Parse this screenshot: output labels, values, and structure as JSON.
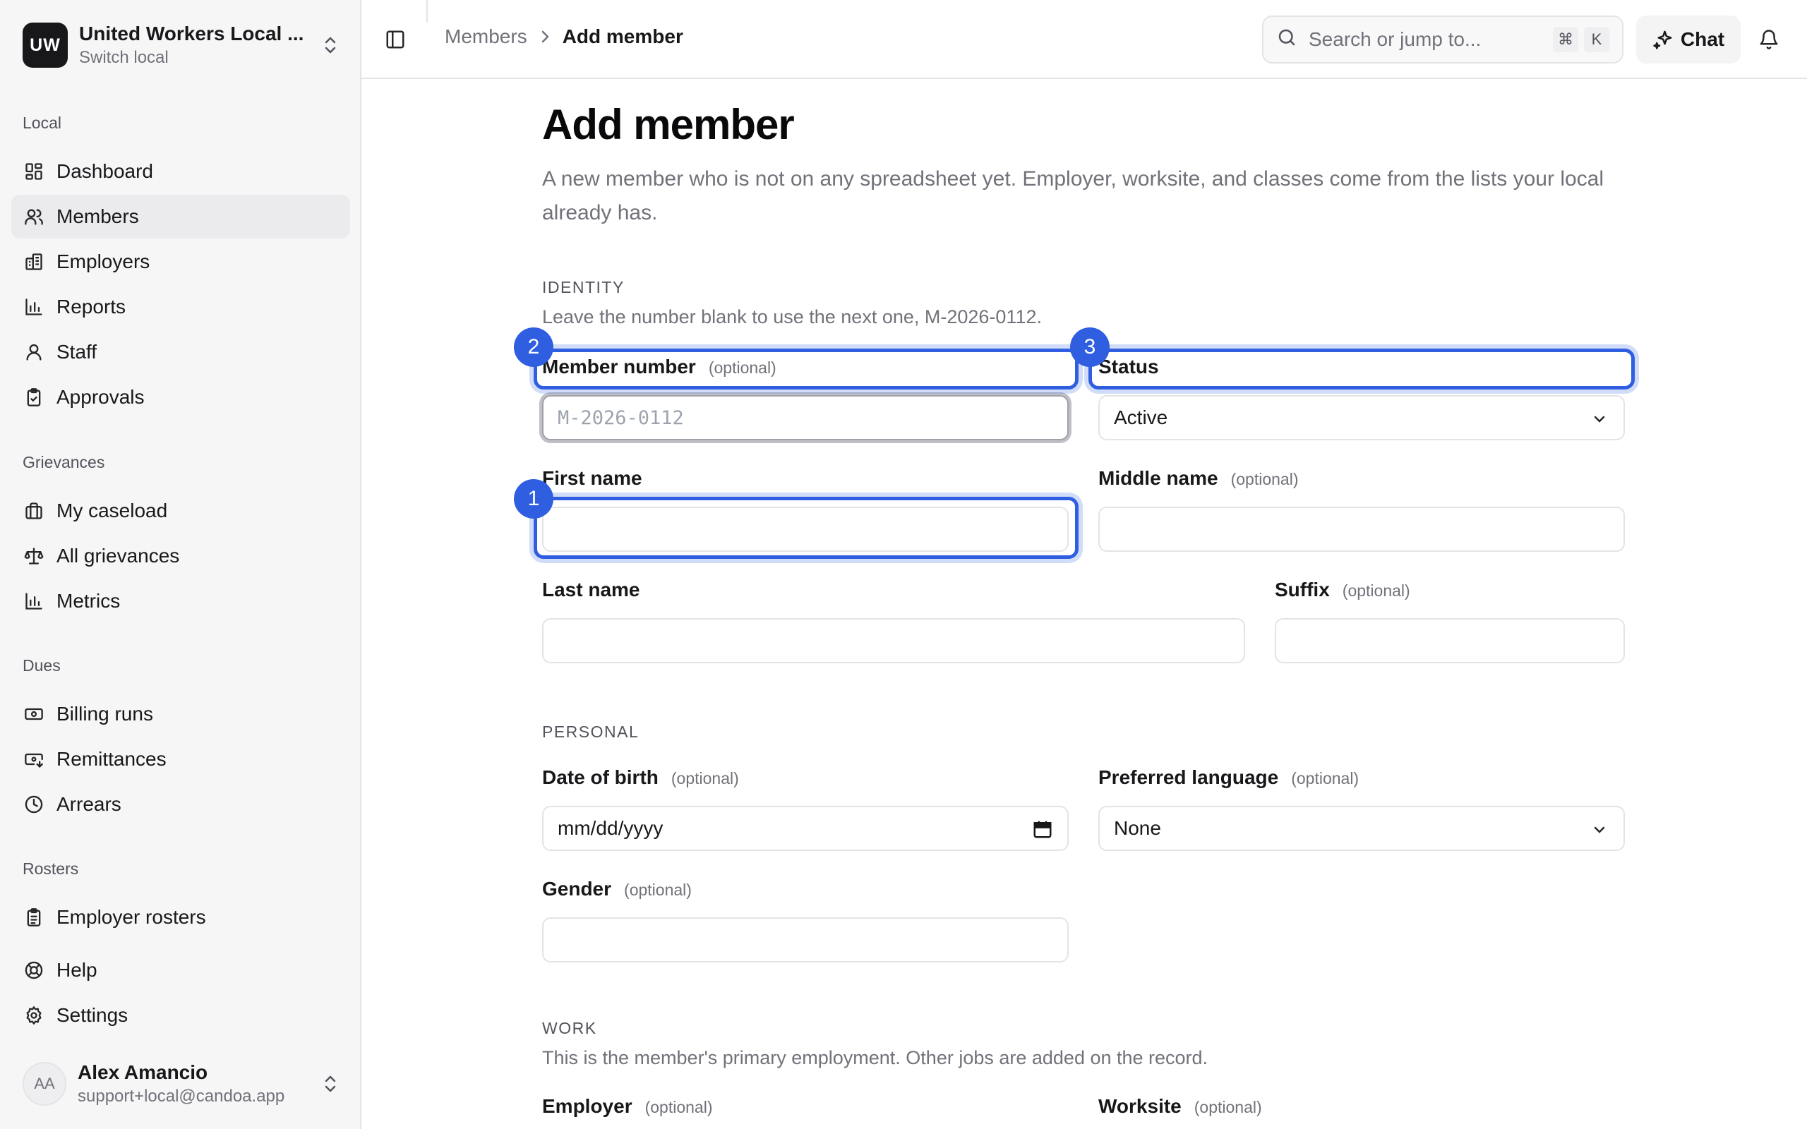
{
  "org": {
    "avatar": "UW",
    "name": "United Workers Local ...",
    "switch_label": "Switch local"
  },
  "nav": {
    "local_label": "Local",
    "local_items": [
      {
        "label": "Dashboard",
        "icon": "dashboard-icon"
      },
      {
        "label": "Members",
        "icon": "users-icon",
        "active": true
      },
      {
        "label": "Employers",
        "icon": "building-icon"
      },
      {
        "label": "Reports",
        "icon": "bar-chart-icon"
      },
      {
        "label": "Staff",
        "icon": "user-icon"
      },
      {
        "label": "Approvals",
        "icon": "clipboard-check-icon"
      }
    ],
    "grievances_label": "Grievances",
    "grievance_items": [
      {
        "label": "My caseload",
        "icon": "briefcase-icon"
      },
      {
        "label": "All grievances",
        "icon": "scale-icon"
      },
      {
        "label": "Metrics",
        "icon": "bar-chart-icon"
      }
    ],
    "dues_label": "Dues",
    "dues_items": [
      {
        "label": "Billing runs",
        "icon": "banknote-icon"
      },
      {
        "label": "Remittances",
        "icon": "money-in-icon"
      },
      {
        "label": "Arrears",
        "icon": "clock-icon"
      }
    ],
    "rosters_label": "Rosters",
    "roster_items": [
      {
        "label": "Employer rosters",
        "icon": "clipboard-list-icon"
      }
    ],
    "help_label": "Help",
    "settings_label": "Settings"
  },
  "user": {
    "initials": "AA",
    "name": "Alex Amancio",
    "email": "support+local@candoa.app"
  },
  "topbar": {
    "breadcrumb_parent": "Members",
    "breadcrumb_current": "Add member",
    "search_placeholder": "Search or jump to...",
    "shortcut_mod": "⌘",
    "shortcut_key": "K",
    "chat_label": "Chat"
  },
  "page": {
    "title": "Add member",
    "description": "A new member who is not on any spreadsheet yet. Employer, worksite, and classes come from the lists your local already has."
  },
  "identity": {
    "section_label": "IDENTITY",
    "help": "Leave the number blank to use the next one, M-2026-0112.",
    "member_number_label": "Member number",
    "member_number_placeholder": "M-2026-0112",
    "status_label": "Status",
    "status_value": "Active",
    "first_name_label": "First name",
    "first_name_value": "",
    "middle_name_label": "Middle name",
    "middle_name_value": "",
    "last_name_label": "Last name",
    "last_name_value": "",
    "suffix_label": "Suffix",
    "suffix_value": ""
  },
  "personal": {
    "section_label": "PERSONAL",
    "dob_label": "Date of birth",
    "dob_placeholder": "mm/dd/yyyy",
    "language_label": "Preferred language",
    "language_value": "None",
    "gender_label": "Gender",
    "gender_value": ""
  },
  "work": {
    "section_label": "WORK",
    "help": "This is the member's primary employment. Other jobs are added on the record.",
    "employer_label": "Employer",
    "worksite_label": "Worksite"
  },
  "optional_label": "(optional)",
  "annotations": {
    "badge_1": "1",
    "badge_2": "2",
    "badge_3": "3"
  },
  "colors": {
    "highlight": "#2f5fe0",
    "sidebar_bg": "#f6f6f7",
    "text": "#18181b",
    "muted": "#71717a"
  }
}
